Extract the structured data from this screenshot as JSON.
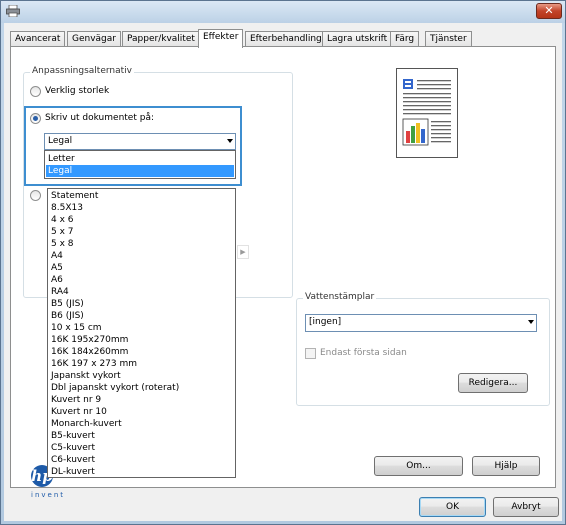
{
  "window": {
    "close_label": "✕",
    "icon": "printer-icon"
  },
  "tabs": [
    {
      "label": "Avancerat"
    },
    {
      "label": "Genvägar"
    },
    {
      "label": "Papper/kvalitet"
    },
    {
      "label": "Effekter",
      "active": true
    },
    {
      "label": "Efterbehandling"
    },
    {
      "label": "Lagra utskrift"
    },
    {
      "label": "Färg"
    },
    {
      "label": "Tjänster"
    }
  ],
  "fit": {
    "group_label": "Anpassningsalternativ",
    "actual_size_label": "Verklig storlek",
    "print_on_label": "Skriv ut dokumentet på:",
    "selected_value": "Legal",
    "dropdown_items": [
      "Letter",
      "Legal"
    ],
    "dropdown_selected": "Legal",
    "paper_list": [
      "Statement",
      "8.5X13",
      "4 x 6",
      "5 x 7",
      "5 x 8",
      "A4",
      "A5",
      "A6",
      "RA4",
      "B5 (JIS)",
      "B6 (JIS)",
      "10 x 15 cm",
      "16K 195x270mm",
      "16K 184x260mm",
      "16K 197 x 273 mm",
      "Japanskt vykort",
      "Dbl japanskt vykort (roterat)",
      "Kuvert nr 9",
      "Kuvert nr 10",
      "Monarch-kuvert",
      "B5-kuvert",
      "C5-kuvert",
      "C6-kuvert",
      "DL-kuvert"
    ]
  },
  "watermark": {
    "group_label": "Vattenstämplar",
    "selected_value": "[ingen]",
    "first_page_only_label": "Endast första sidan",
    "first_page_only_checked": false,
    "edit_button": "Redigera..."
  },
  "footer": {
    "about_button": "Om...",
    "help_button": "Hjälp",
    "ok_button": "OK",
    "cancel_button": "Avbryt"
  },
  "branding": {
    "logo_text": "hp",
    "tagline": "invent"
  },
  "colors": {
    "accent": "#3399ff",
    "focus_border": "#3e8ed0",
    "hp_blue": "#1d5aa8"
  }
}
